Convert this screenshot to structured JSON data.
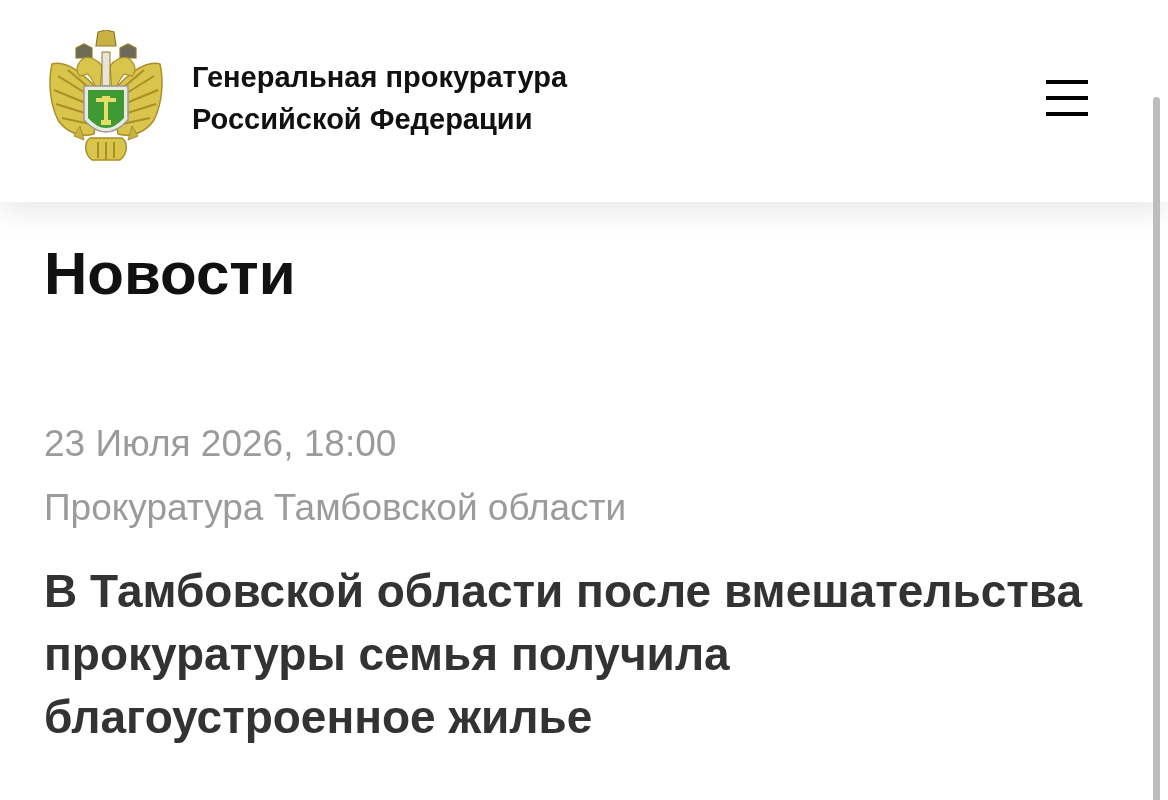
{
  "header": {
    "site_name": "Генеральная прокуратура Российской Федерации"
  },
  "section_title": "Новости",
  "article": {
    "date": "23 Июля 2026, 18:00",
    "source": "Прокуратура Тамбовской области",
    "headline": "В Тамбовской области после вмешательства прокуратуры семья получила благоустроенное жилье"
  }
}
